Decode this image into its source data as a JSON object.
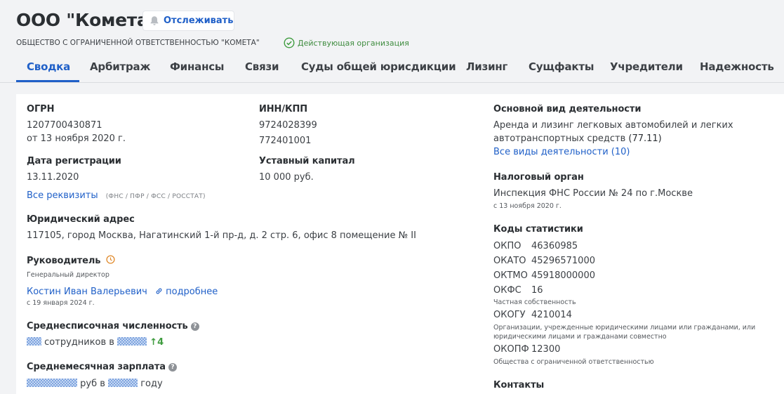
{
  "header": {
    "title": "ООО \"Комета\"",
    "follow_label": "Отслеживать",
    "full_name": "ОБЩЕСТВО С ОГРАНИЧЕННОЙ ОТВЕТСТВЕННОСТЬЮ \"КОМЕТА\"",
    "status": "Действующая организация"
  },
  "tabs": [
    "Сводка",
    "Арбитраж",
    "Финансы",
    "Связи",
    "Суды общей юрисдикции",
    "Лизинг",
    "Сущфакты",
    "Учредители",
    "Надежность"
  ],
  "ogrn": {
    "label": "ОГРН",
    "value": "1207700430871",
    "date": "от 13 ноября 2020 г."
  },
  "inn": {
    "label": "ИНН/КПП",
    "inn": "9724028399",
    "kpp": "772401001"
  },
  "reg": {
    "label": "Дата регистрации",
    "value": "13.11.2020"
  },
  "capital": {
    "label": "Уставный капитал",
    "value": "10 000 руб."
  },
  "requisites": {
    "link": "Все реквизиты",
    "sources": "(ФНС / ПФР / ФСС / РОССТАТ)"
  },
  "address": {
    "label": "Юридический адрес",
    "value": "117105, город Москва, Нагатинский 1-й пр-д, д. 2 стр. 6, офис 8 помещение № II"
  },
  "head": {
    "label": "Руководитель",
    "position": "Генеральный директор",
    "name": "Костин Иван Валерьевич",
    "more": "подробнее",
    "since": "с 19 января 2024 г."
  },
  "staff": {
    "label": "Среднесписочная численность",
    "text1": "сотрудников в",
    "delta": "4"
  },
  "salary": {
    "label": "Среднемесячная зарплата",
    "text1": "руб в",
    "text2": "году"
  },
  "activity": {
    "label": "Основной вид деятельности",
    "line1": "Аренда и лизинг легковых автомобилей и легких",
    "line2": "автотранспортных средств",
    "code": "(77.11)",
    "link": "Все виды деятельности (10)"
  },
  "tax": {
    "label": "Налоговый орган",
    "value": "Инспекция ФНС России № 24 по г.Москве",
    "since": "с 13 ноября 2020 г."
  },
  "stats": {
    "label": "Коды статистики",
    "okpo_k": "ОКПО",
    "okpo_v": "46360985",
    "okato_k": "ОКАТО",
    "okato_v": "45296571000",
    "oktmo_k": "ОКТМО",
    "oktmo_v": "45918000000",
    "okfs_k": "ОКФС",
    "okfs_v": "16",
    "okfs_d": "Частная собственность",
    "okogu_k": "ОКОГУ",
    "okogu_v": "4210014",
    "okogu_d1": "Организации, учрежденные юридическими лицами или гражданами, или",
    "okogu_d2": "юридическими лицами и гражданами совместно",
    "okopf_k": "ОКОПФ",
    "okopf_v": "12300",
    "okopf_d": "Общества с ограниченной ответственностью"
  },
  "contacts": {
    "label": "Контакты"
  },
  "colors": {
    "accent": "#2060c8",
    "status": "#3f8c3f",
    "background": "#f2f3f5"
  }
}
